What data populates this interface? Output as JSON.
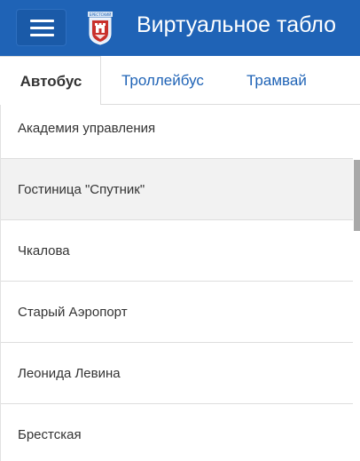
{
  "header": {
    "title": "Виртуальное табло",
    "menu_icon": "hamburger-icon",
    "logo_icon": "city-coat-of-arms-icon",
    "logo_text": "БРЕСТСКИЙ",
    "background_color": "#1f63b6"
  },
  "tabs": [
    {
      "label": "Автобус",
      "active": true
    },
    {
      "label": "Троллейбус",
      "active": false
    },
    {
      "label": "Трамвай",
      "active": false
    }
  ],
  "stops": [
    {
      "name": "Академия управления"
    },
    {
      "name": "Гостиница \"Спутник\""
    },
    {
      "name": "Чкалова"
    },
    {
      "name": "Старый Аэропорт"
    },
    {
      "name": "Леонида Левина"
    },
    {
      "name": "Брестская"
    }
  ],
  "colors": {
    "accent": "#1f63b6",
    "text": "#333333",
    "row_highlight": "#f2f2f2",
    "divider": "#dddddd"
  }
}
